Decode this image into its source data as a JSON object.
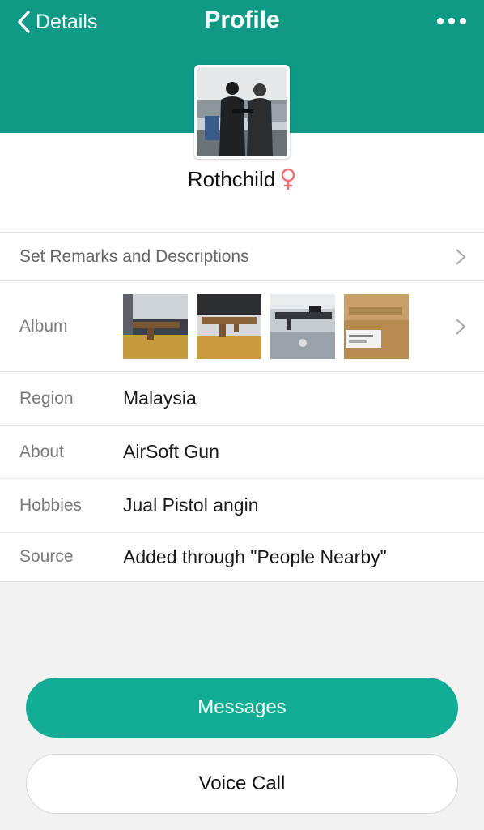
{
  "nav": {
    "back_label": "Details",
    "title": "Profile",
    "more_icon": "more-dots-icon",
    "accent_color": "#0f9a86"
  },
  "profile": {
    "name": "Rothchild",
    "gender_icon": "female-symbol-icon",
    "gender_color": "#f26b6b"
  },
  "remarks": {
    "label": "Set Remarks and Descriptions"
  },
  "album": {
    "label": "Album",
    "photo_count": 4
  },
  "info_rows": [
    {
      "label": "Region",
      "value": "Malaysia"
    },
    {
      "label": "About",
      "value": "AirSoft Gun"
    },
    {
      "label": "Hobbies",
      "value": "Jual Pistol angin"
    },
    {
      "label": "Source",
      "value": "Added through \"People Nearby\""
    }
  ],
  "buttons": {
    "messages": "Messages",
    "voice_call": "Voice Call",
    "primary_color": "#13ad95"
  }
}
